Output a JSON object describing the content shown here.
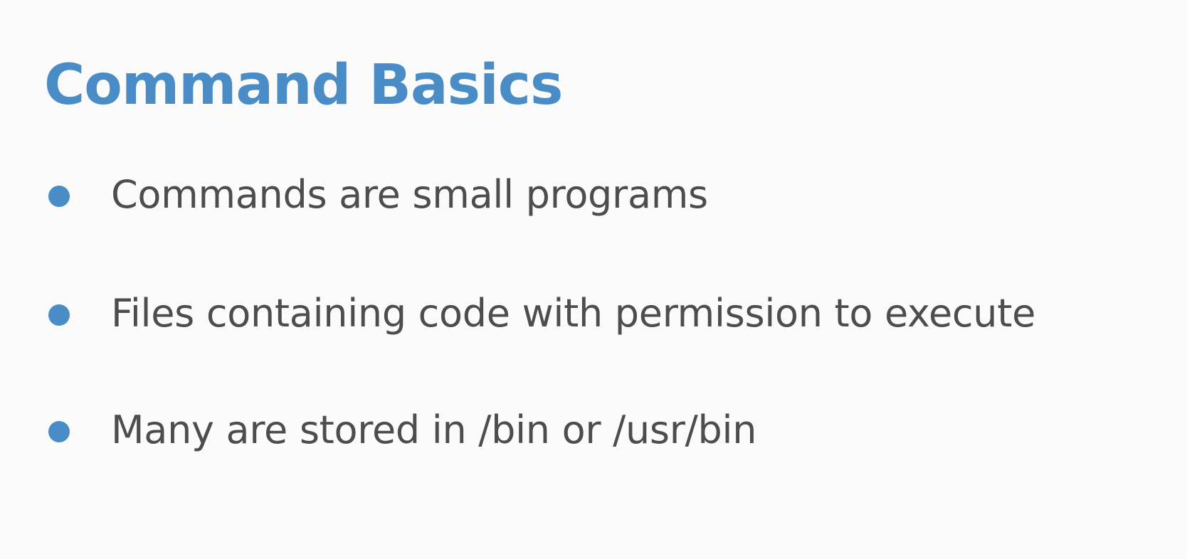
{
  "colors": {
    "accent": "#4a8cc5",
    "text": "#4d4d4d",
    "background": "#fbfbfb"
  },
  "slide": {
    "title": "Command Basics",
    "bullets": [
      {
        "text": "Commands are small programs"
      },
      {
        "text": "Files containing code with permission to execute"
      },
      {
        "text": "Many are stored in /bin or /usr/bin"
      }
    ]
  }
}
